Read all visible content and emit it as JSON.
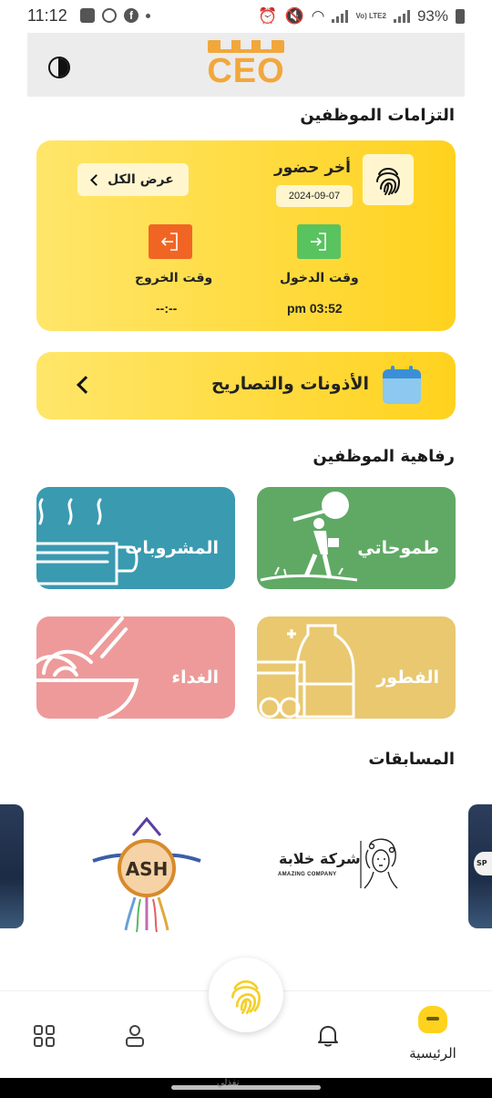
{
  "status_bar": {
    "time": "11:12",
    "battery": "93%",
    "lte": "Vo) LTE2"
  },
  "header": {
    "logo_text": "CEO"
  },
  "commitments": {
    "title": "التزامات الموظفين",
    "last_attendance_label": "أخر حضور",
    "date": "2024-09-07",
    "view_all": "عرض الكل",
    "check_in_label": "وقت الدخول",
    "check_in_value": "pm 03:52",
    "check_out_label": "وقت الخروج",
    "check_out_value": "--:--"
  },
  "leaves": {
    "label": "الأذونات والتصاريح"
  },
  "welfare": {
    "title": "رفاهية الموظفين",
    "items": [
      {
        "label": "طموحاتي",
        "color": "#5fa965"
      },
      {
        "label": "المشروبات",
        "color": "#3a9ab0"
      },
      {
        "label": "الفطور",
        "color": "#e9c870"
      },
      {
        "label": "الغداء",
        "color": "#ee9a9a"
      }
    ]
  },
  "competitions": {
    "title": "المسابقات",
    "logos": [
      {
        "name": "ASH"
      },
      {
        "name": "شركة خلابة",
        "subtitle": "AMAZING COMPANY"
      }
    ]
  },
  "bottom_nav": {
    "home_label": "الرئيسية"
  },
  "watermark": "نفذلي"
}
